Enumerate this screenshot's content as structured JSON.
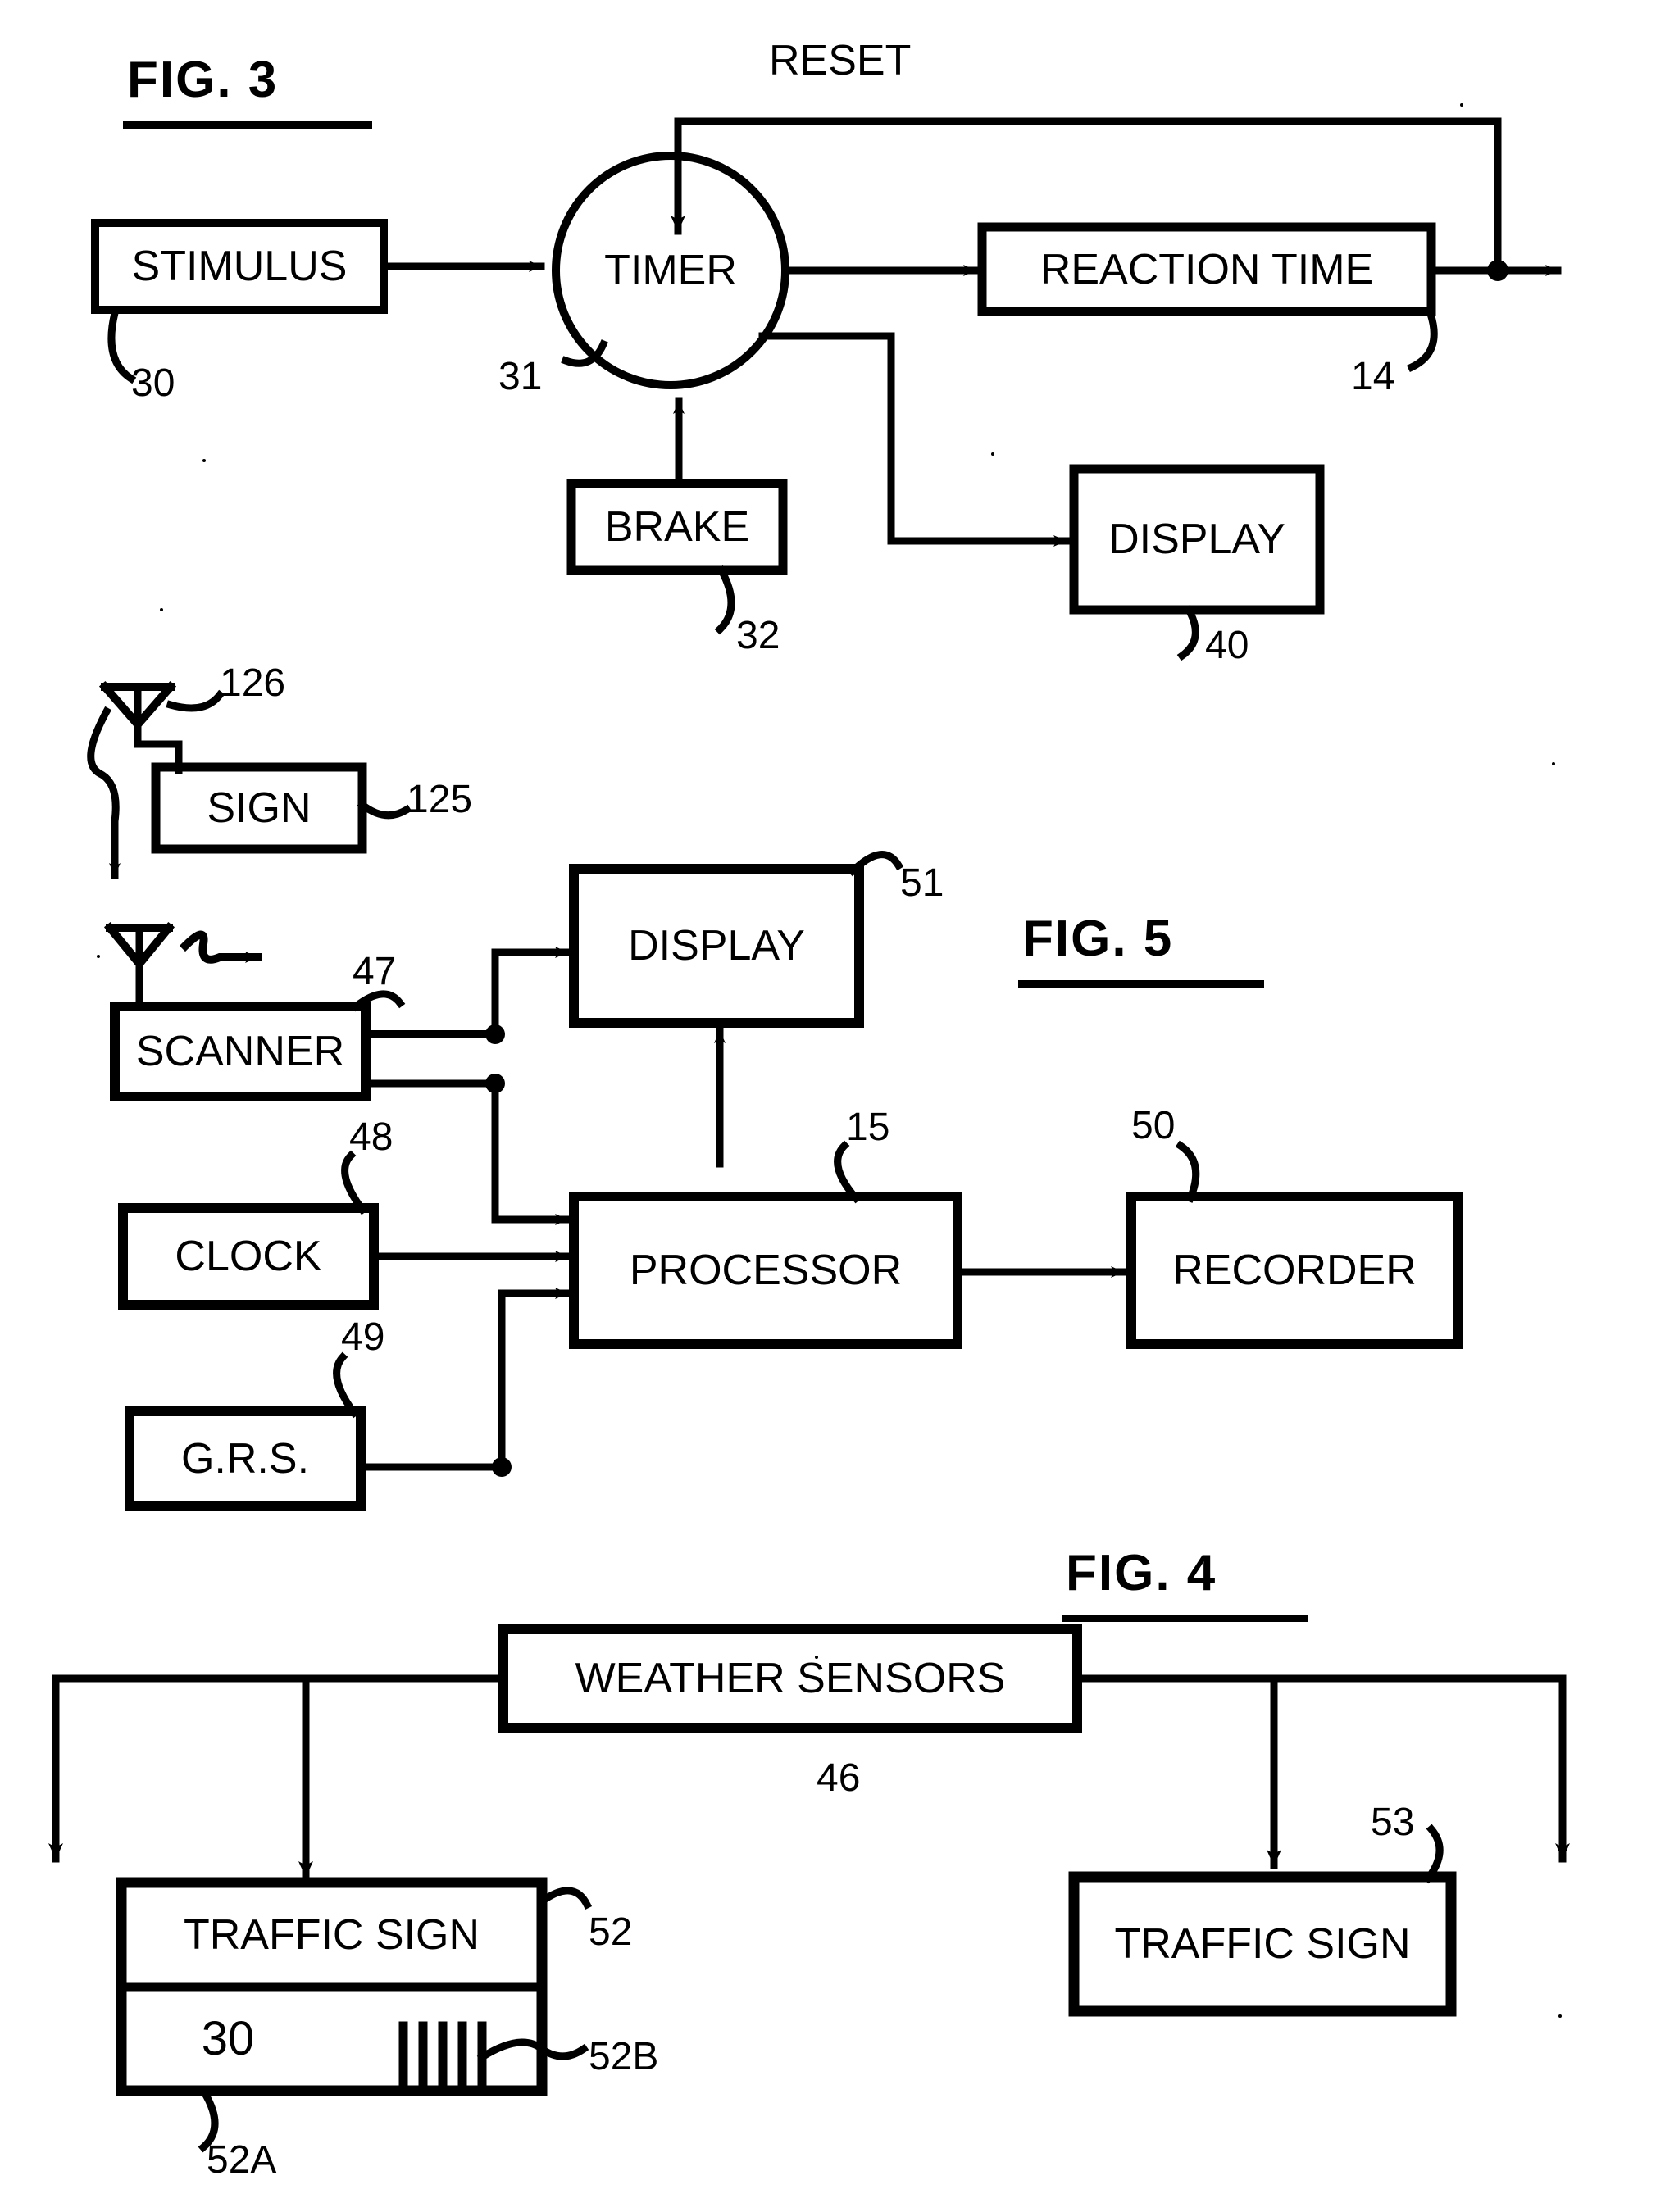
{
  "document": {
    "type": "patent-figure-sheet",
    "figures": [
      "FIG. 3",
      "FIG. 5",
      "FIG. 4"
    ]
  },
  "fig3": {
    "title": "FIG. 3",
    "blocks": {
      "stimulus": {
        "label": "STIMULUS",
        "ref": "30"
      },
      "timer": {
        "label": "TIMER",
        "ref": "31"
      },
      "brake": {
        "label": "BRAKE",
        "ref": "32"
      },
      "reaction_time": {
        "label": "REACTION TIME",
        "ref": "14"
      },
      "display": {
        "label": "DISPLAY",
        "ref": "40"
      }
    },
    "wire_labels": {
      "reset": "RESET"
    }
  },
  "fig5": {
    "title": "FIG. 5",
    "blocks": {
      "sign": {
        "label": "SIGN",
        "ref": "125"
      },
      "sign_antenna": {
        "ref": "126"
      },
      "scanner": {
        "label": "SCANNER",
        "ref": "47"
      },
      "clock": {
        "label": "CLOCK",
        "ref": "48"
      },
      "grs": {
        "label": "G.R.S.",
        "ref": "49"
      },
      "processor": {
        "label": "PROCESSOR",
        "ref": "15"
      },
      "display": {
        "label": "DISPLAY",
        "ref": "51"
      },
      "recorder": {
        "label": "RECORDER",
        "ref": "50"
      }
    }
  },
  "fig4": {
    "title": "FIG. 4",
    "blocks": {
      "weather_sensors": {
        "label": "WEATHER SENSORS",
        "ref": "46"
      },
      "traffic_sign_left": {
        "label": "TRAFFIC SIGN",
        "ref": "52"
      },
      "traffic_sign_left_lower": {
        "label": "30",
        "ref": "52A"
      },
      "traffic_sign_left_barcode": {
        "ref": "52B"
      },
      "traffic_sign_right": {
        "label": "TRAFFIC SIGN",
        "ref": "53"
      }
    }
  },
  "style": {
    "ink": "#000000",
    "paper": "#ffffff"
  }
}
